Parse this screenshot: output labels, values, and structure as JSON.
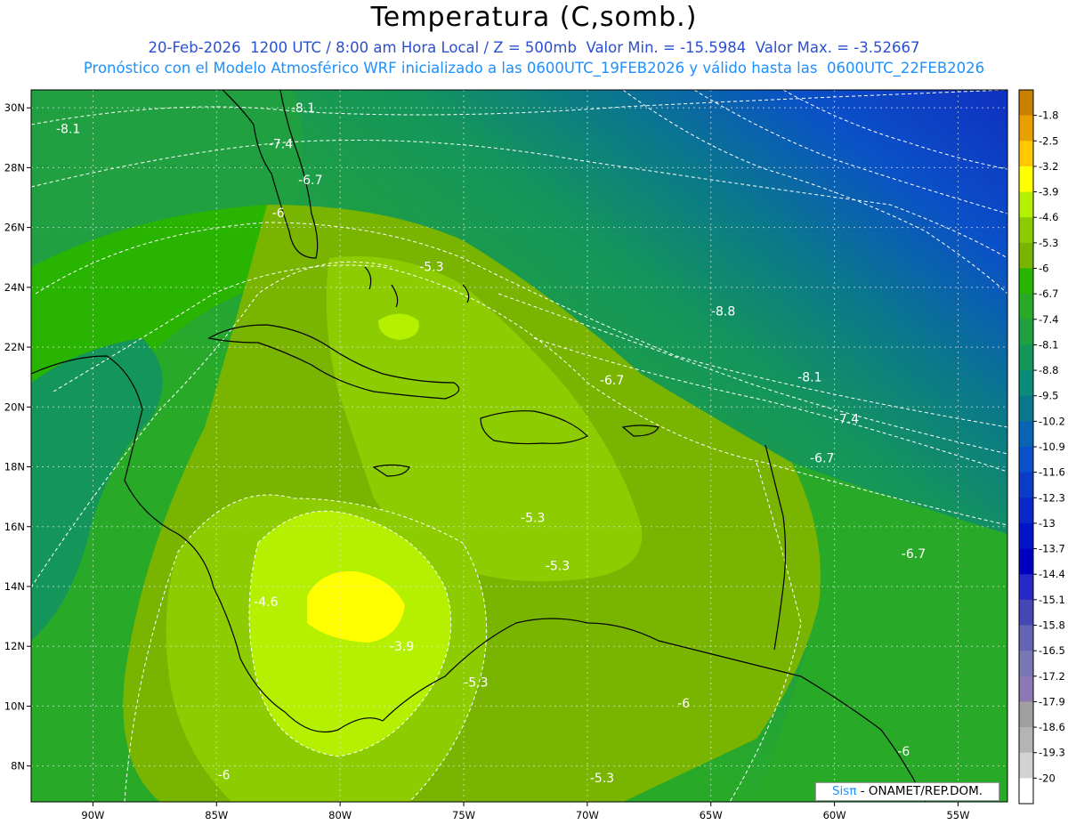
{
  "header": {
    "title": "Temperatura (C,somb.)",
    "subtitle_line1": "20-Feb-2026  1200 UTC / 8:00 am Hora Local / Z = 500mb  Valor Min. = -15.5984  Valor Max. = -3.52667",
    "subtitle_line2": "Pronóstico con el Modelo Atmosférico WRF inicializado a las 0600UTC_19FEB2026 y válido hasta las  0600UTC_22FEB2026"
  },
  "map": {
    "lon_range": [
      -92.5,
      -53
    ],
    "lat_range": [
      6.8,
      30.6
    ],
    "lon_ticks": [
      "90W",
      "85W",
      "80W",
      "75W",
      "70W",
      "65W",
      "60W",
      "55W"
    ],
    "lon_tick_values": [
      -90,
      -85,
      -80,
      -75,
      -70,
      -65,
      -60,
      -55
    ],
    "lat_ticks": [
      "30N",
      "28N",
      "26N",
      "24N",
      "22N",
      "20N",
      "18N",
      "16N",
      "14N",
      "12N",
      "10N",
      "8N"
    ],
    "lat_tick_values": [
      30,
      28,
      26,
      24,
      22,
      20,
      18,
      16,
      14,
      12,
      10,
      8
    ],
    "contour_labels": [
      {
        "text": "-8.1",
        "lon": -91.0,
        "lat": 29.3
      },
      {
        "text": "-8.1",
        "lon": -81.5,
        "lat": 30.0
      },
      {
        "text": "-7.4",
        "lon": -82.4,
        "lat": 28.8
      },
      {
        "text": "-6.7",
        "lon": -81.2,
        "lat": 27.6
      },
      {
        "text": "-6",
        "lon": -82.5,
        "lat": 26.5
      },
      {
        "text": "-5.3",
        "lon": -76.3,
        "lat": 24.7
      },
      {
        "text": "-8.8",
        "lon": -64.5,
        "lat": 23.2
      },
      {
        "text": "-6.7",
        "lon": -69.0,
        "lat": 20.9
      },
      {
        "text": "-8.1",
        "lon": -61.0,
        "lat": 21.0
      },
      {
        "text": "-7.4",
        "lon": -59.5,
        "lat": 19.6
      },
      {
        "text": "-6.7",
        "lon": -60.5,
        "lat": 18.3
      },
      {
        "text": "-5.3",
        "lon": -72.2,
        "lat": 16.3
      },
      {
        "text": "-6.7",
        "lon": -56.8,
        "lat": 15.1
      },
      {
        "text": "-5.3",
        "lon": -71.2,
        "lat": 14.7
      },
      {
        "text": "-4.6",
        "lon": -83.0,
        "lat": 13.5
      },
      {
        "text": "-3.9",
        "lon": -77.5,
        "lat": 12.0
      },
      {
        "text": "-5.3",
        "lon": -74.5,
        "lat": 10.8
      },
      {
        "text": "-6",
        "lon": -66.1,
        "lat": 10.1
      },
      {
        "text": "-6",
        "lon": -57.2,
        "lat": 8.5
      },
      {
        "text": "-6",
        "lon": -84.7,
        "lat": 7.7
      },
      {
        "text": "-5.3",
        "lon": -69.4,
        "lat": 7.6
      }
    ]
  },
  "colorbar": {
    "labels": [
      "-1.8",
      "-2.5",
      "-3.2",
      "-3.9",
      "-4.6",
      "-5.3",
      "-6",
      "-6.7",
      "-7.4",
      "-8.1",
      "-8.8",
      "-9.5",
      "-10.2",
      "-10.9",
      "-11.6",
      "-12.3",
      "-13",
      "-13.7",
      "-14.4",
      "-15.1",
      "-15.8",
      "-16.5",
      "-17.2",
      "-17.9",
      "-18.6",
      "-19.3",
      "-20"
    ],
    "colors": [
      "#c88000",
      "#e8a000",
      "#ffc800",
      "#ffff00",
      "#b4f000",
      "#8ccc00",
      "#78b400",
      "#28b400",
      "#28aa28",
      "#20a040",
      "#14965a",
      "#0a8c78",
      "#0a788c",
      "#0a64b4",
      "#0a50c8",
      "#0a3cc8",
      "#0a28c8",
      "#0014c8",
      "#0000c0",
      "#2828c8",
      "#4646b4",
      "#6464b4",
      "#7878b4",
      "#8c78b4",
      "#a0a0a0",
      "#b4b4b4",
      "#d2d2d2",
      "#ffffff"
    ]
  },
  "credit": {
    "brand": "SisPi",
    "pi_glyph": "π",
    "brand_prefix": "Sis",
    "text": " - ONAMET/REP.DOM."
  },
  "field_colors": {
    "deep_blue": "#1030c0",
    "blue": "#0a64b4",
    "teal": "#0a8c78",
    "dark_green": "#14965a",
    "green": "#28aa28",
    "bright_green": "#28b400",
    "olive": "#78b400",
    "lime": "#8ccc00",
    "yellow_green": "#b4f000",
    "yellow": "#ffff00",
    "coast": "#000000",
    "grid": "#e6e6e6",
    "contour": "#ffffff"
  }
}
